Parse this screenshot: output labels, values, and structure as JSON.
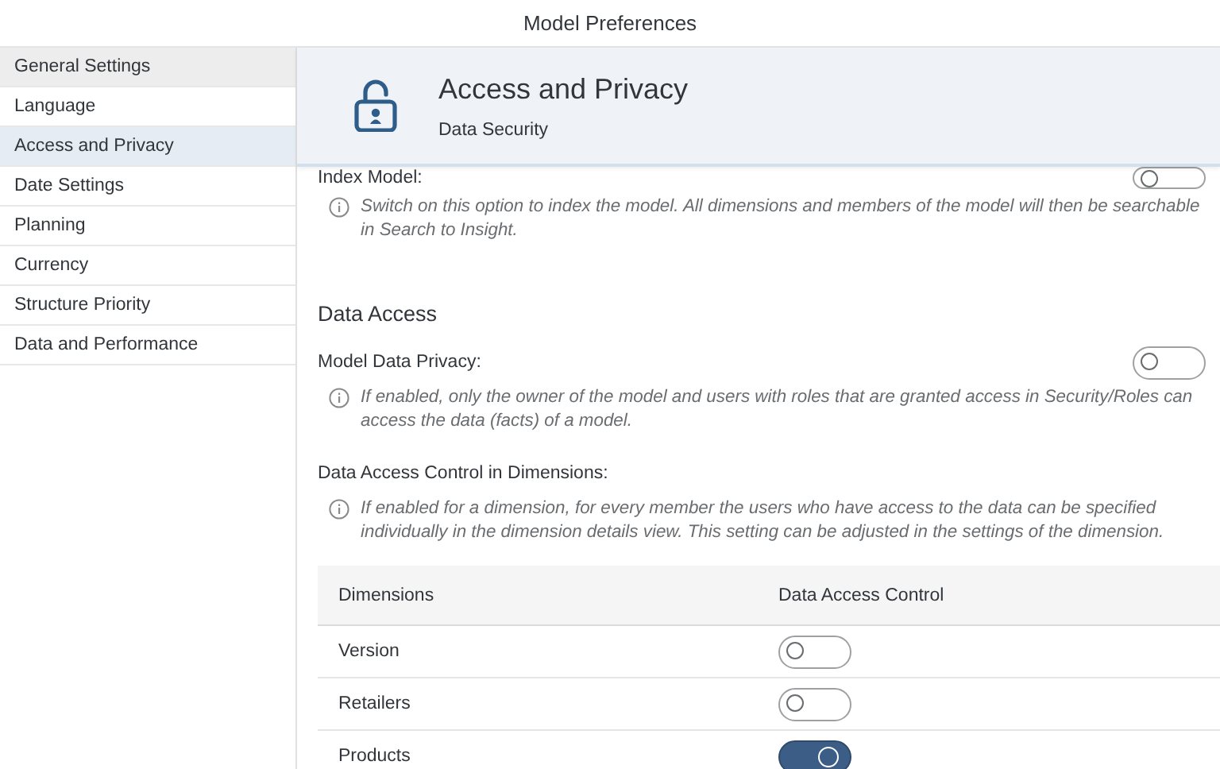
{
  "window": {
    "title": "Model Preferences"
  },
  "sidebar": {
    "items": [
      {
        "label": "General Settings",
        "kind": "group"
      },
      {
        "label": "Language",
        "kind": "item",
        "selected": false
      },
      {
        "label": "Access and Privacy",
        "kind": "item",
        "selected": true
      },
      {
        "label": "Date Settings",
        "kind": "item",
        "selected": false
      },
      {
        "label": "Planning",
        "kind": "item",
        "selected": false
      },
      {
        "label": "Currency",
        "kind": "item",
        "selected": false
      },
      {
        "label": "Structure Priority",
        "kind": "item",
        "selected": false
      },
      {
        "label": "Data and Performance",
        "kind": "item",
        "selected": false
      }
    ]
  },
  "header": {
    "title": "Access and Privacy",
    "subtitle": "Data Security"
  },
  "index_model": {
    "label": "Index Model:",
    "on": false,
    "note": "Switch on this option to index the model. All dimensions and members of the model will then be searchable in Search to Insight."
  },
  "data_access": {
    "heading": "Data Access",
    "privacy": {
      "label": "Model Data Privacy:",
      "on": false,
      "note": "If enabled, only the owner of the model and users with roles that are granted access in Security/Roles can access the data (facts) of a model."
    },
    "dimensions": {
      "label": "Data Access Control in Dimensions:",
      "note": "If enabled for a dimension, for every member the users who have access to the data can be specified individually in the dimension details view. This setting can be adjusted in the settings of the dimension.",
      "table": {
        "columns": [
          "Dimensions",
          "Data Access Control"
        ],
        "rows": [
          {
            "dimension": "Version",
            "on": false
          },
          {
            "dimension": "Retailers",
            "on": false
          },
          {
            "dimension": "Products",
            "on": true
          }
        ]
      }
    }
  }
}
